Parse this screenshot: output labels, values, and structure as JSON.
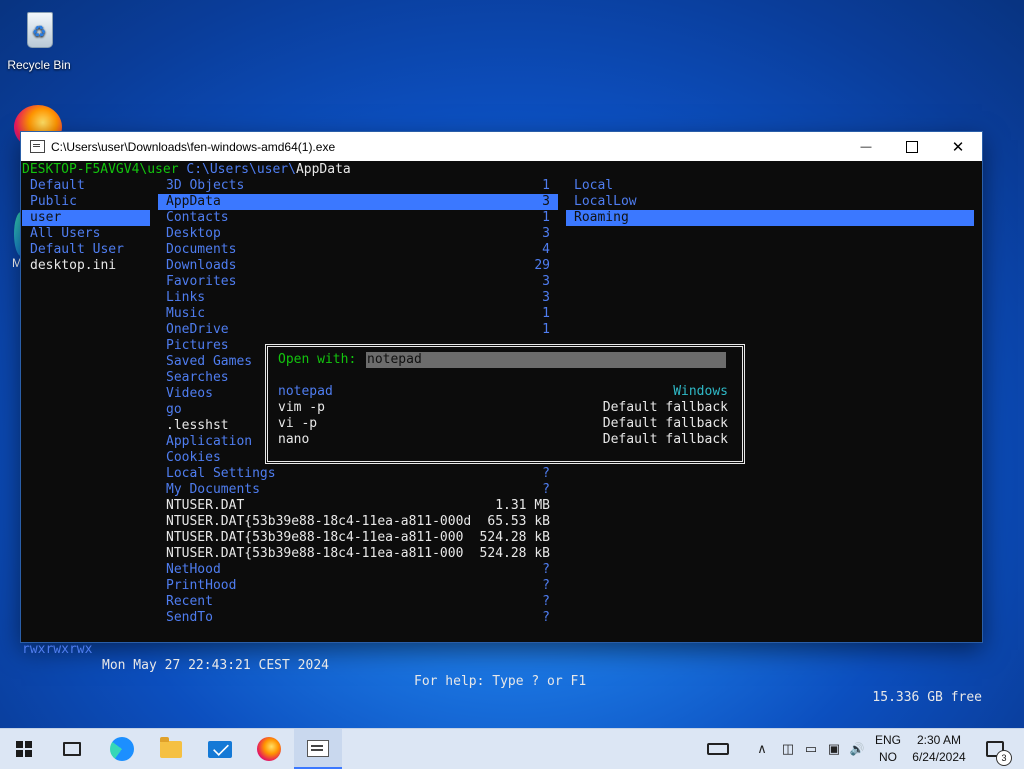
{
  "desktop": {
    "recycle_bin_label": "Recycle Bin",
    "partial_label": "M"
  },
  "window": {
    "title": "C:\\Users\\user\\Downloads\\fen-windows-amd64(1).exe",
    "minimize_glyph": "—",
    "close_glyph": "✕"
  },
  "fen": {
    "path_host": "DESKTOP-F5AVGV4\\user",
    "path_dir": "C:\\Users\\user\\",
    "path_current": "AppData",
    "left_pane": [
      {
        "name": "Default",
        "type": "dir"
      },
      {
        "name": "Public",
        "type": "dir"
      },
      {
        "name": "user",
        "type": "dir",
        "selected": true
      },
      {
        "name": "All Users",
        "type": "dir"
      },
      {
        "name": "Default User",
        "type": "dir"
      },
      {
        "name": "desktop.ini",
        "type": "file"
      }
    ],
    "middle_pane": [
      {
        "name": "3D Objects",
        "count": "1",
        "type": "dir"
      },
      {
        "name": "AppData",
        "count": "3",
        "type": "dir",
        "selected": true
      },
      {
        "name": "Contacts",
        "count": "1",
        "type": "dir"
      },
      {
        "name": "Desktop",
        "count": "3",
        "type": "dir"
      },
      {
        "name": "Documents",
        "count": "4",
        "type": "dir"
      },
      {
        "name": "Downloads",
        "count": "29",
        "type": "dir"
      },
      {
        "name": "Favorites",
        "count": "3",
        "type": "dir"
      },
      {
        "name": "Links",
        "count": "3",
        "type": "dir"
      },
      {
        "name": "Music",
        "count": "1",
        "type": "dir"
      },
      {
        "name": "OneDrive",
        "count": "1",
        "type": "dir"
      },
      {
        "name": "Pictures",
        "count": "",
        "type": "dir"
      },
      {
        "name": "Saved Games",
        "count": "",
        "type": "dir"
      },
      {
        "name": "Searches",
        "count": "",
        "type": "dir"
      },
      {
        "name": "Videos",
        "count": "",
        "type": "dir"
      },
      {
        "name": "go",
        "count": "",
        "type": "dir"
      },
      {
        "name": ".lesshst",
        "count": "",
        "type": "file"
      },
      {
        "name": "Application",
        "count": "",
        "type": "dir"
      },
      {
        "name": "Cookies",
        "count": "",
        "type": "dir"
      },
      {
        "name": "Local Settings",
        "count": "?",
        "type": "dir"
      },
      {
        "name": "My Documents",
        "count": "?",
        "type": "dir"
      },
      {
        "name": "NTUSER.DAT",
        "count": "1.31 MB",
        "type": "file"
      },
      {
        "name": "NTUSER.DAT{53b39e88-18c4-11ea-a811-000d",
        "count": "65.53 kB",
        "type": "file"
      },
      {
        "name": "NTUSER.DAT{53b39e88-18c4-11ea-a811-000",
        "count": "524.28 kB",
        "type": "file"
      },
      {
        "name": "NTUSER.DAT{53b39e88-18c4-11ea-a811-000",
        "count": "524.28 kB",
        "type": "file"
      },
      {
        "name": "NetHood",
        "count": "?",
        "type": "dir"
      },
      {
        "name": "PrintHood",
        "count": "?",
        "type": "dir"
      },
      {
        "name": "Recent",
        "count": "?",
        "type": "dir"
      },
      {
        "name": "SendTo",
        "count": "?",
        "type": "dir"
      }
    ],
    "right_pane": [
      {
        "name": "Local",
        "selected": false
      },
      {
        "name": "LocalLow",
        "selected": false
      },
      {
        "name": "Roaming",
        "selected": true
      }
    ],
    "popup": {
      "prompt": "Open with:",
      "input_value": "notepad",
      "options": [
        {
          "name": "notepad",
          "source": "Windows"
        },
        {
          "name": "vim -p",
          "source": "Default fallback"
        },
        {
          "name": "vi -p",
          "source": "Default fallback"
        },
        {
          "name": "nano",
          "source": "Default fallback"
        }
      ]
    },
    "status": {
      "permissions": "rwxrwxrwx",
      "modified": "Mon May 27 22:43:21 CEST 2024",
      "help": "For help: Type ? or F1",
      "free": "15.336 GB free"
    }
  },
  "taskbar": {
    "items": [
      {
        "name": "start",
        "icon": "windows-start-icon"
      },
      {
        "name": "task-view",
        "icon": "task-view-icon"
      },
      {
        "name": "edge",
        "icon": "edge-icon"
      },
      {
        "name": "file-explorer",
        "icon": "folder-icon"
      },
      {
        "name": "mail",
        "icon": "mail-icon"
      },
      {
        "name": "firefox",
        "icon": "firefox-icon"
      },
      {
        "name": "terminal",
        "icon": "terminal-icon",
        "active": true
      }
    ],
    "tray": {
      "chevron": "∧",
      "language_top": "ENG",
      "language_bottom": "NO",
      "time": "2:30 AM",
      "date": "6/24/2024",
      "notification_count": "3",
      "volume_glyph": "🔊"
    }
  },
  "colors": {
    "terminal_bg": "#0c0c0c",
    "dir_blue": "#4f7df0",
    "selection": "#3b78ff",
    "prompt_green": "#13c40e",
    "input_bg": "#6c6c6c"
  }
}
